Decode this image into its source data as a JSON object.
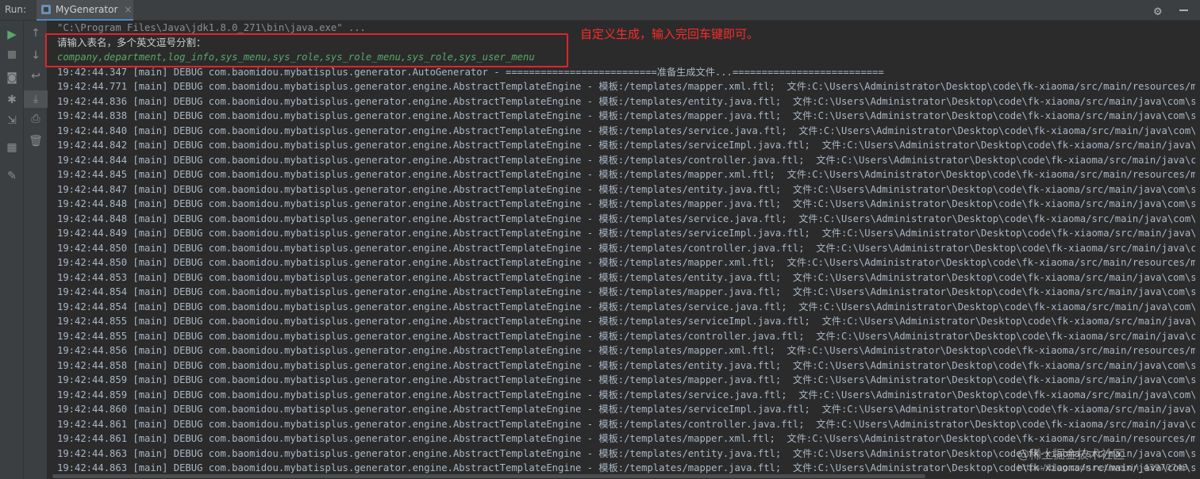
{
  "header": {
    "run_label": "Run:",
    "tab_title": "MyGenerator",
    "tab_close": "×"
  },
  "icons": {
    "run": "play-icon",
    "stop": "stop-icon",
    "up": "arrow-up-icon",
    "down": "arrow-down-icon",
    "settings": "gear-icon"
  },
  "console": {
    "command_line": "\"C:\\Program Files\\Java\\jdk1.8.0_271\\bin\\java.exe\" ...",
    "prompt": "请输入表名，多个英文逗号分割：",
    "user_input": "company,department,log_info,sys_menu,sys_role,sys_role_menu,sys_role,sys_user_menu",
    "log_lines": [
      "19:42:44.347 [main] DEBUG com.baomidou.mybatisplus.generator.AutoGenerator - ==========================准备生成文件...==========================",
      "19:42:44.771 [main] DEBUG com.baomidou.mybatisplus.generator.engine.AbstractTemplateEngine - 模板:/templates/mapper.xml.ftl;  文件:C:\\Users\\Administrator\\Desktop\\code\\fk-xiaoma/src/main/resources/map",
      "19:42:44.836 [main] DEBUG com.baomidou.mybatisplus.generator.engine.AbstractTemplateEngine - 模板:/templates/entity.java.ftl;  文件:C:\\Users\\Administrator\\Desktop\\code\\fk-xiaoma/src/main/java\\com\\sys",
      "19:42:44.838 [main] DEBUG com.baomidou.mybatisplus.generator.engine.AbstractTemplateEngine - 模板:/templates/mapper.java.ftl;  文件:C:\\Users\\Administrator\\Desktop\\code\\fk-xiaoma/src/main/java\\com\\sys",
      "19:42:44.840 [main] DEBUG com.baomidou.mybatisplus.generator.engine.AbstractTemplateEngine - 模板:/templates/service.java.ftl;  文件:C:\\Users\\Administrator\\Desktop\\code\\fk-xiaoma/src/main/java\\com\\sy",
      "19:42:44.842 [main] DEBUG com.baomidou.mybatisplus.generator.engine.AbstractTemplateEngine - 模板:/templates/serviceImpl.java.ftl;  文件:C:\\Users\\Administrator\\Desktop\\code\\fk-xiaoma/src/main/java\\co",
      "19:42:44.844 [main] DEBUG com.baomidou.mybatisplus.generator.engine.AbstractTemplateEngine - 模板:/templates/controller.java.ftl;  文件:C:\\Users\\Administrator\\Desktop\\code\\fk-xiaoma/src/main/java\\com",
      "19:42:44.845 [main] DEBUG com.baomidou.mybatisplus.generator.engine.AbstractTemplateEngine - 模板:/templates/mapper.xml.ftl;  文件:C:\\Users\\Administrator\\Desktop\\code\\fk-xiaoma/src/main/resources/map",
      "19:42:44.847 [main] DEBUG com.baomidou.mybatisplus.generator.engine.AbstractTemplateEngine - 模板:/templates/entity.java.ftl;  文件:C:\\Users\\Administrator\\Desktop\\code\\fk-xiaoma/src/main/java\\com\\sys",
      "19:42:44.848 [main] DEBUG com.baomidou.mybatisplus.generator.engine.AbstractTemplateEngine - 模板:/templates/mapper.java.ftl;  文件:C:\\Users\\Administrator\\Desktop\\code\\fk-xiaoma/src/main/java\\com\\sys",
      "19:42:44.848 [main] DEBUG com.baomidou.mybatisplus.generator.engine.AbstractTemplateEngine - 模板:/templates/service.java.ftl;  文件:C:\\Users\\Administrator\\Desktop\\code\\fk-xiaoma/src/main/java\\com\\sy",
      "19:42:44.849 [main] DEBUG com.baomidou.mybatisplus.generator.engine.AbstractTemplateEngine - 模板:/templates/serviceImpl.java.ftl;  文件:C:\\Users\\Administrator\\Desktop\\code\\fk-xiaoma/src/main/java\\co",
      "19:42:44.850 [main] DEBUG com.baomidou.mybatisplus.generator.engine.AbstractTemplateEngine - 模板:/templates/controller.java.ftl;  文件:C:\\Users\\Administrator\\Desktop\\code\\fk-xiaoma/src/main/java\\com",
      "19:42:44.850 [main] DEBUG com.baomidou.mybatisplus.generator.engine.AbstractTemplateEngine - 模板:/templates/mapper.xml.ftl;  文件:C:\\Users\\Administrator\\Desktop\\code\\fk-xiaoma/src/main/resources/map",
      "19:42:44.853 [main] DEBUG com.baomidou.mybatisplus.generator.engine.AbstractTemplateEngine - 模板:/templates/entity.java.ftl;  文件:C:\\Users\\Administrator\\Desktop\\code\\fk-xiaoma/src/main/java\\com\\sys",
      "19:42:44.854 [main] DEBUG com.baomidou.mybatisplus.generator.engine.AbstractTemplateEngine - 模板:/templates/mapper.java.ftl;  文件:C:\\Users\\Administrator\\Desktop\\code\\fk-xiaoma/src/main/java\\com\\sys",
      "19:42:44.854 [main] DEBUG com.baomidou.mybatisplus.generator.engine.AbstractTemplateEngine - 模板:/templates/service.java.ftl;  文件:C:\\Users\\Administrator\\Desktop\\code\\fk-xiaoma/src/main/java\\com\\sy",
      "19:42:44.855 [main] DEBUG com.baomidou.mybatisplus.generator.engine.AbstractTemplateEngine - 模板:/templates/serviceImpl.java.ftl;  文件:C:\\Users\\Administrator\\Desktop\\code\\fk-xiaoma/src/main/java\\co",
      "19:42:44.855 [main] DEBUG com.baomidou.mybatisplus.generator.engine.AbstractTemplateEngine - 模板:/templates/controller.java.ftl;  文件:C:\\Users\\Administrator\\Desktop\\code\\fk-xiaoma/src/main/java\\com",
      "19:42:44.856 [main] DEBUG com.baomidou.mybatisplus.generator.engine.AbstractTemplateEngine - 模板:/templates/mapper.xml.ftl;  文件:C:\\Users\\Administrator\\Desktop\\code\\fk-xiaoma/src/main/resources/map",
      "19:42:44.858 [main] DEBUG com.baomidou.mybatisplus.generator.engine.AbstractTemplateEngine - 模板:/templates/entity.java.ftl;  文件:C:\\Users\\Administrator\\Desktop\\code\\fk-xiaoma/src/main/java\\com\\sys",
      "19:42:44.859 [main] DEBUG com.baomidou.mybatisplus.generator.engine.AbstractTemplateEngine - 模板:/templates/mapper.java.ftl;  文件:C:\\Users\\Administrator\\Desktop\\code\\fk-xiaoma/src/main/java\\com\\sys",
      "19:42:44.859 [main] DEBUG com.baomidou.mybatisplus.generator.engine.AbstractTemplateEngine - 模板:/templates/service.java.ftl;  文件:C:\\Users\\Administrator\\Desktop\\code\\fk-xiaoma/src/main/java\\com\\sy",
      "19:42:44.860 [main] DEBUG com.baomidou.mybatisplus.generator.engine.AbstractTemplateEngine - 模板:/templates/serviceImpl.java.ftl;  文件:C:\\Users\\Administrator\\Desktop\\code\\fk-xiaoma/src/main/java\\co",
      "19:42:44.861 [main] DEBUG com.baomidou.mybatisplus.generator.engine.AbstractTemplateEngine - 模板:/templates/controller.java.ftl;  文件:C:\\Users\\Administrator\\Desktop\\code\\fk-xiaoma/src/main/java\\com",
      "19:42:44.861 [main] DEBUG com.baomidou.mybatisplus.generator.engine.AbstractTemplateEngine - 模板:/templates/mapper.xml.ftl;  文件:C:\\Users\\Administrator\\Desktop\\code\\fk-xiaoma/src/main/resources/map",
      "19:42:44.863 [main] DEBUG com.baomidou.mybatisplus.generator.engine.AbstractTemplateEngine - 模板:/templates/entity.java.ftl;  文件:C:\\Users\\Administrator\\Desktop\\code\\fk-xiaoma/src/main/java\\com\\sys",
      "19:42:44.863 [main] DEBUG com.baomidou.mybatisplus.generator.engine.AbstractTemplateEngine - 模板:/templates/mapper.java.ftl;  文件:C:\\Users\\Administrator\\Desktop\\code\\fk-xiaoma/src/main/java\\com\\sys"
    ]
  },
  "annotation": {
    "text": "自定义生成，输入完回车键即可。",
    "color": "#ff2b2b"
  },
  "watermark": {
    "text": "@稀土掘金技术社区",
    "url": "https://blog.csdn.net/weixin_43970743"
  },
  "colors": {
    "background": "#2b2b2b",
    "toolbar": "#3c3f41",
    "log_text": "#a9b7c6",
    "input_text": "#59a869",
    "highlight_border": "#e0252b"
  }
}
